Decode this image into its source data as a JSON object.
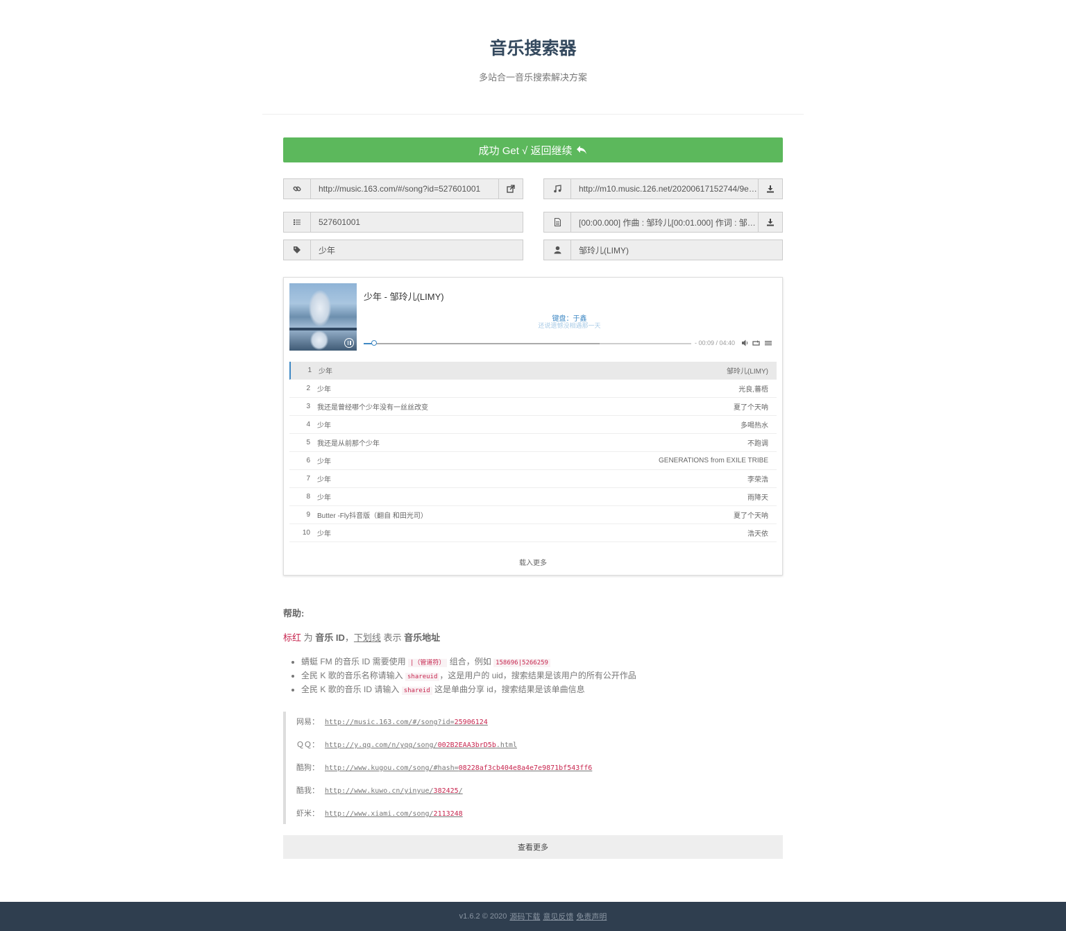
{
  "header": {
    "title": "音乐搜索器",
    "subtitle": "多站合一音乐搜索解决方案"
  },
  "success_button": {
    "label": "成功 Get √ 返回继续"
  },
  "fields": {
    "link": {
      "value": "http://music.163.com/#/song?id=527601001"
    },
    "url": {
      "value": "http://m10.music.126.net/20200617152744/9e5..."
    },
    "id": {
      "value": "527601001"
    },
    "lrc": {
      "value": "[00:00.000] 作曲 : 邹玲儿[00:01.000] 作词 : 邹玲..."
    },
    "name": {
      "value": "少年"
    },
    "author": {
      "value": "邹玲儿(LIMY)"
    }
  },
  "player": {
    "title": "少年",
    "separator": " - ",
    "artist": "邹玲儿(LIMY)",
    "lyric_current": "键盘：于鑫",
    "lyric_next": "还说遗憾没相遇那一天",
    "time": "- 00:09 / 04:40",
    "progress_played": 0.032,
    "load_more": "载入更多"
  },
  "playlist": [
    {
      "index": "1",
      "name": "少年",
      "artist": "邹玲儿(LIMY)"
    },
    {
      "index": "2",
      "name": "少年",
      "artist": "光良,蕃梧"
    },
    {
      "index": "3",
      "name": "我还是曾经哪个少年没有一丝丝改变",
      "artist": "夏了个天呐"
    },
    {
      "index": "4",
      "name": "少年",
      "artist": "多喝热水"
    },
    {
      "index": "5",
      "name": "我还是从前那个少年",
      "artist": "不跑调"
    },
    {
      "index": "6",
      "name": "少年",
      "artist": "GENERATIONS from EXILE TRIBE"
    },
    {
      "index": "7",
      "name": "少年",
      "artist": "李荣浩"
    },
    {
      "index": "8",
      "name": "少年",
      "artist": "雨降天"
    },
    {
      "index": "9",
      "name": "Butter -Fly抖音版（翻自 和田光司）",
      "artist": "夏了个天呐"
    },
    {
      "index": "10",
      "name": "少年",
      "artist": "浩天依"
    }
  ],
  "help": {
    "title": "帮助:",
    "legend": {
      "red": "标红",
      "t1": " 为 ",
      "id": "音乐 ID",
      "t2": "，",
      "underline": "下划线",
      "t3": " 表示 ",
      "addr": "音乐地址"
    },
    "tips": [
      {
        "pre": "蜻蜓 FM 的音乐 ID 需要使用 ",
        "code": "|（管道符）",
        "post": " 组合，例如 ",
        "code2": "158696|5266259"
      },
      {
        "pre": "全民 K 歌的音乐名称请输入 ",
        "code": "shareuid",
        "post": "，这是用户的 uid，搜索结果是该用户的所有公开作品"
      },
      {
        "pre": "全民 K 歌的音乐 ID 请输入 ",
        "code": "shareid",
        "post": " 这是单曲分享 id，搜索结果是该单曲信息"
      }
    ],
    "examples": [
      {
        "label": "网易：",
        "url": "http://music.163.com/#/song?id=",
        "id": "25906124"
      },
      {
        "label": "ＱＱ：",
        "url": "http://y.qq.com/n/yqq/song/",
        "id": "002B2EAA3brD5b",
        "suffix": ".html"
      },
      {
        "label": "酷狗：",
        "url": "http://www.kugou.com/song/#hash=",
        "id": "08228af3cb404e8a4e7e9871bf543ff6"
      },
      {
        "label": "酷我：",
        "url": "http://www.kuwo.cn/yinyue/",
        "id": "382425",
        "suffix": "/"
      },
      {
        "label": "虾米：",
        "url": "http://www.xiami.com/song/",
        "id": "2113248"
      }
    ],
    "more_label": "查看更多"
  },
  "footer": {
    "version": "v1.6.2 © 2020",
    "source": "源码下载",
    "feedback": "意见反馈",
    "disclaimer": "免责声明"
  },
  "colors": {
    "success": "#5cb85c",
    "accent": "#3e88c4",
    "code": "#c7254e",
    "footer_bg": "#2f3e4f"
  },
  "icons": {
    "link": "link-icon",
    "open": "external-link-icon",
    "music": "music-icon",
    "download": "download-icon",
    "list": "list-icon",
    "file": "file-icon",
    "tag": "tag-icon",
    "user": "user-icon"
  }
}
